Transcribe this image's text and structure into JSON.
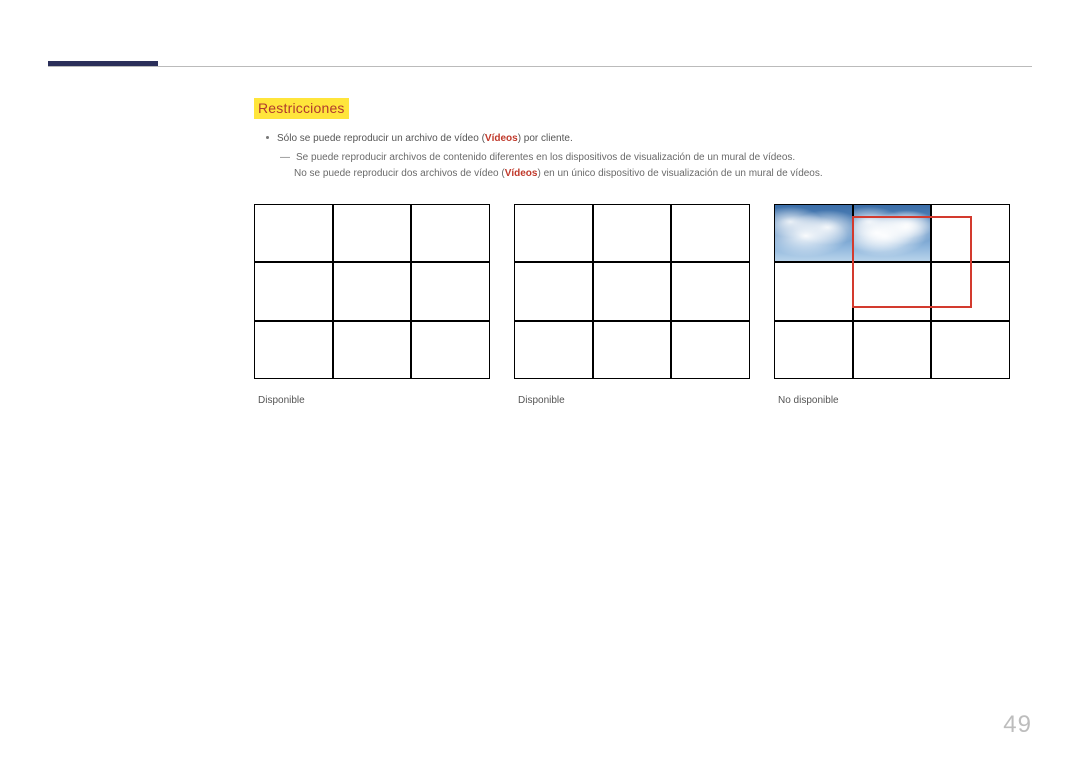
{
  "section": {
    "title": "Restricciones",
    "bullet1_pre": "Sólo se puede reproducir un archivo de vídeo (",
    "bullet1_em": "Vídeos",
    "bullet1_post": ") por cliente.",
    "sub1": "Se puede reproducir archivos de contenido diferentes en los dispositivos de visualización de un mural de vídeos.",
    "sub2_pre": "No se puede reproducir dos archivos de vídeo (",
    "sub2_em": "Vídeos",
    "sub2_post": ") en un único dispositivo de visualización de un mural de vídeos."
  },
  "grids": {
    "g1_caption": "Disponible",
    "g2_caption": "Disponible",
    "g3_caption": "No disponible"
  },
  "page_number": "49"
}
